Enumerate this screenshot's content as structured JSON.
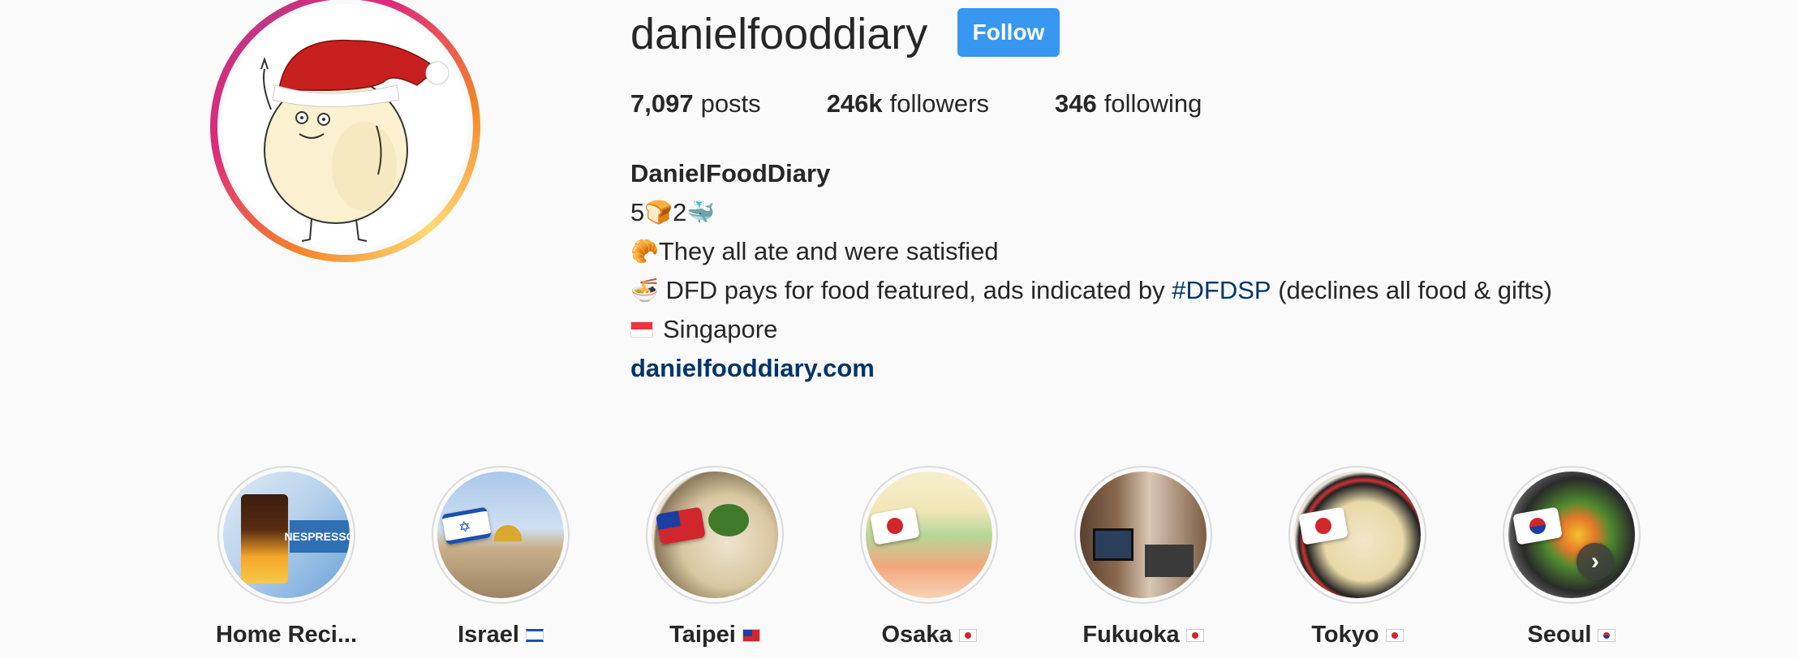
{
  "profile": {
    "username": "danielfooddiary",
    "follow_label": "Follow",
    "avatar_icon": "avatar-mascot-santa-hat"
  },
  "stats": {
    "posts_count": "7,097",
    "posts_label": "posts",
    "followers_count": "246k",
    "followers_label": "followers",
    "following_count": "346",
    "following_label": "following"
  },
  "bio": {
    "name": "DanielFoodDiary",
    "line1_text_a": "5",
    "line1_emoji_a": "🍞",
    "line1_text_b": "2",
    "line1_emoji_b": "🐳",
    "line2_emoji": "🥐",
    "line2_text": "They all ate and were satisfied",
    "line3_emoji": "🍜",
    "line3_text_a": " DFD pays for food featured, ads indicated by ",
    "line3_hashtag": "#DFDSP",
    "line3_text_b": " (declines all food & gifts)",
    "line4_text": "Singapore",
    "website": "danielfooddiary.com"
  },
  "highlights": [
    {
      "label": "Home Reci..."
    },
    {
      "label": "Israel"
    },
    {
      "label": "Taipei"
    },
    {
      "label": "Osaka"
    },
    {
      "label": "Fukuoka"
    },
    {
      "label": "Tokyo"
    },
    {
      "label": "Seoul"
    }
  ],
  "colors": {
    "follow_blue": "#3897f0",
    "link_blue": "#003569",
    "text": "#262626",
    "background": "#fafafa"
  }
}
